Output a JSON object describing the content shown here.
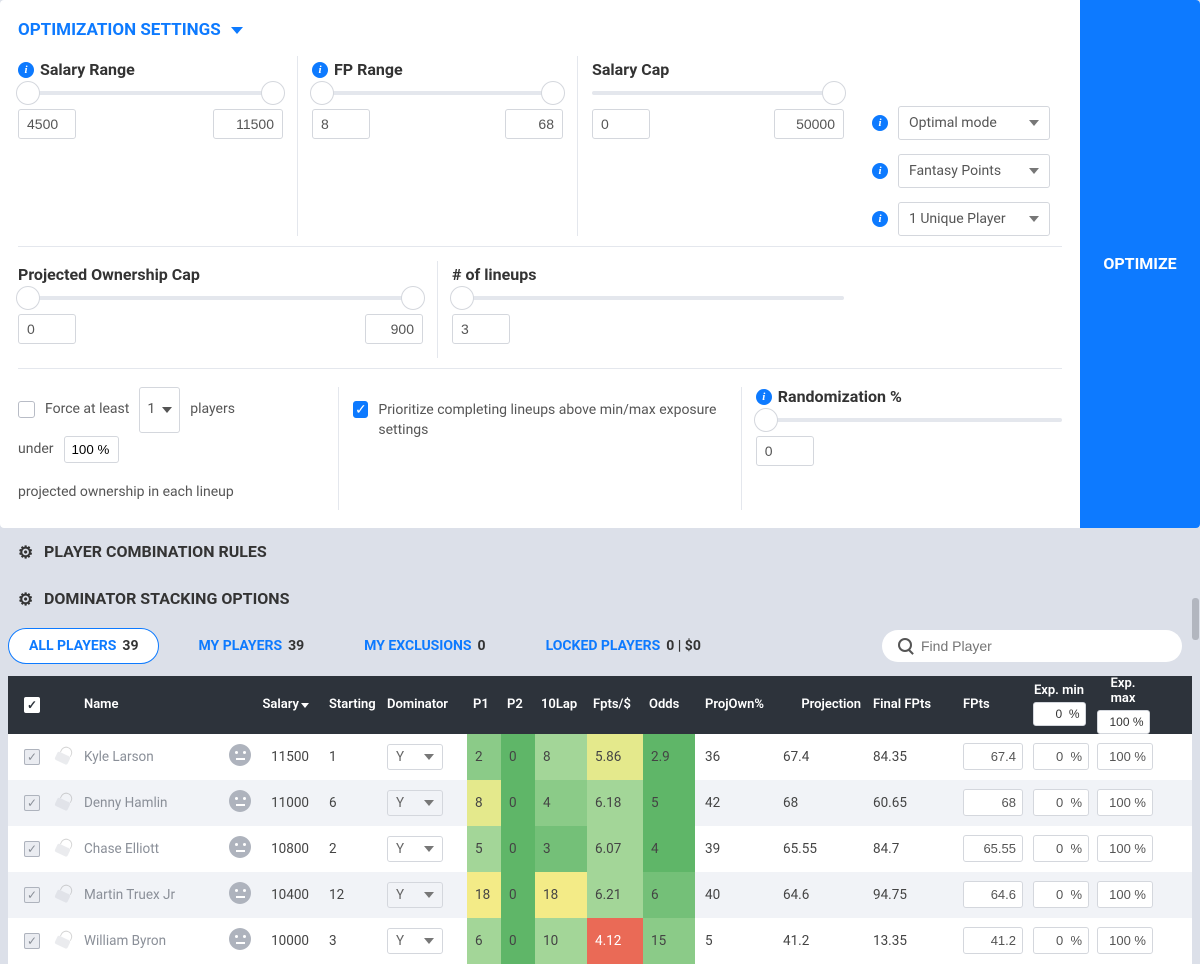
{
  "header": {
    "title": "OPTIMIZATION SETTINGS"
  },
  "settings": {
    "salaryRange": {
      "label": "Salary Range",
      "min": "4500",
      "max": "11500"
    },
    "fpRange": {
      "label": "FP Range",
      "min": "8",
      "max": "68"
    },
    "salaryCap": {
      "label": "Salary Cap",
      "min": "0",
      "max": "50000"
    },
    "projOwnCap": {
      "label": "Projected Ownership Cap",
      "min": "0",
      "max": "900"
    },
    "numLineups": {
      "label": "# of lineups",
      "value": "3"
    },
    "mode": {
      "selected": "Optimal mode"
    },
    "metric": {
      "selected": "Fantasy Points"
    },
    "unique": {
      "selected": "1 Unique Player"
    },
    "force": {
      "label1": "Force at least",
      "count": "1",
      "label2": "players",
      "label3": "under",
      "pct": "100 %",
      "label4": "projected ownership in each lineup"
    },
    "prioritize": {
      "label": "Prioritize completing lineups above min/max exposure settings"
    },
    "randomization": {
      "label": "Randomization %",
      "value": "0"
    }
  },
  "optimizeButton": "OPTIMIZE",
  "subSections": {
    "rules": "PLAYER COMBINATION RULES",
    "stacking": "DOMINATOR STACKING OPTIONS"
  },
  "tabs": {
    "all": {
      "label": "ALL PLAYERS",
      "count": "39"
    },
    "my": {
      "label": "MY PLAYERS",
      "count": "39"
    },
    "excl": {
      "label": "MY EXCLUSIONS",
      "count": "0"
    },
    "locked": {
      "label": "LOCKED PLAYERS",
      "count": "0 | $0"
    }
  },
  "search": {
    "placeholder": "Find Player"
  },
  "columns": {
    "name": "Name",
    "salary": "Salary",
    "starting": "Starting",
    "dominator": "Dominator",
    "p1": "P1",
    "p2": "P2",
    "lap": "10Lap",
    "fptsS": "Fpts/$",
    "odds": "Odds",
    "projOwn": "ProjOwn%",
    "projection": "Projection",
    "finalFpts": "Final FPts",
    "fpts": "FPts",
    "expMin": "Exp. min",
    "expMax": "Exp. max",
    "expMinVal": "0  %",
    "expMaxVal": "100 %"
  },
  "rows": [
    {
      "name": "Kyle Larson",
      "salary": "11500",
      "starting": "1",
      "dom": "Y",
      "p1": "2",
      "p1c": "c-g3",
      "p2": "0",
      "p2c": "c-g1",
      "lap": "8",
      "lapc": "c-g4",
      "fptsS": "5.86",
      "fptsSc": "c-y1",
      "odds": "2.9",
      "oddsc": "c-g1",
      "projOwn": "36",
      "proj": "67.4",
      "final": "84.35",
      "fptsIn": "67.4",
      "min": "0  %",
      "max": "100 %"
    },
    {
      "name": "Denny Hamlin",
      "salary": "11000",
      "starting": "6",
      "dom": "Y",
      "p1": "8",
      "p1c": "c-y1",
      "p2": "0",
      "p2c": "c-g1",
      "lap": "4",
      "lapc": "c-g3",
      "fptsS": "6.18",
      "fptsSc": "c-g4",
      "odds": "5",
      "oddsc": "c-g1",
      "projOwn": "42",
      "proj": "68",
      "final": "60.65",
      "fptsIn": "68",
      "min": "0  %",
      "max": "100 %"
    },
    {
      "name": "Chase Elliott",
      "salary": "10800",
      "starting": "2",
      "dom": "Y",
      "p1": "5",
      "p1c": "c-g4",
      "p2": "0",
      "p2c": "c-g1",
      "lap": "3",
      "lapc": "c-g2",
      "fptsS": "6.07",
      "fptsSc": "c-g4",
      "odds": "4",
      "oddsc": "c-g1",
      "projOwn": "39",
      "proj": "65.55",
      "final": "84.7",
      "fptsIn": "65.55",
      "min": "0  %",
      "max": "100 %"
    },
    {
      "name": "Martin Truex Jr",
      "salary": "10400",
      "starting": "12",
      "dom": "Y",
      "p1": "18",
      "p1c": "c-y2",
      "p2": "0",
      "p2c": "c-g1",
      "lap": "18",
      "lapc": "c-y2",
      "fptsS": "6.21",
      "fptsSc": "c-g4",
      "odds": "6",
      "oddsc": "c-g2",
      "projOwn": "40",
      "proj": "64.6",
      "final": "94.75",
      "fptsIn": "64.6",
      "min": "0  %",
      "max": "100 %"
    },
    {
      "name": "William Byron",
      "salary": "10000",
      "starting": "3",
      "dom": "Y",
      "p1": "6",
      "p1c": "c-g4",
      "p2": "0",
      "p2c": "c-g1",
      "lap": "10",
      "lapc": "c-g4",
      "fptsS": "4.12",
      "fptsSc": "c-r2",
      "odds": "15",
      "oddsc": "c-g3",
      "projOwn": "5",
      "proj": "41.2",
      "final": "13.35",
      "fptsIn": "41.2",
      "min": "0  %",
      "max": "100 %"
    }
  ]
}
